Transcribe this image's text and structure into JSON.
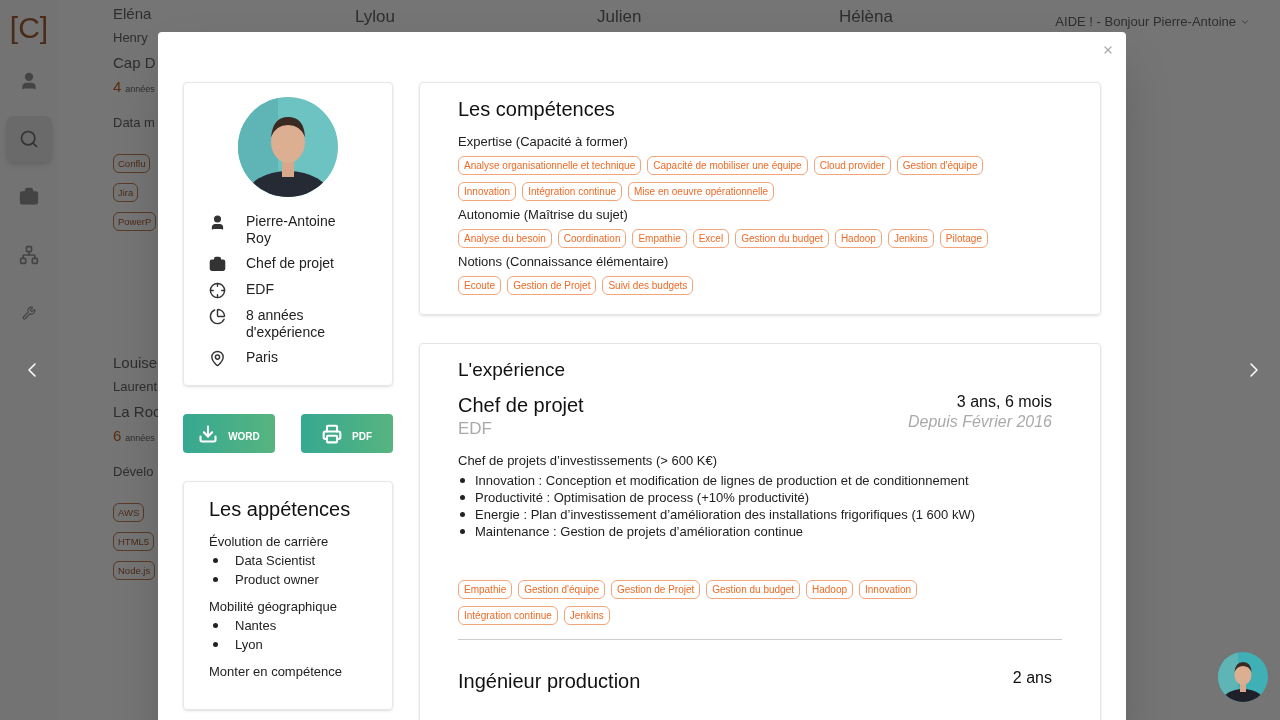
{
  "sidebar": {
    "logo": "[C]",
    "items": [
      {
        "kind": "user",
        "selected": false
      },
      {
        "kind": "search",
        "selected": true
      },
      {
        "kind": "briefcase",
        "selected": false
      },
      {
        "kind": "network",
        "selected": false
      },
      {
        "kind": "tools",
        "selected": false
      }
    ]
  },
  "header": {
    "greeting": "AIDE ! - Bonjour Pierre-Antoine"
  },
  "top_names": [
    "Lylou",
    "Julien",
    "Hélèna"
  ],
  "background_cards": [
    {
      "first_name": "Eléna",
      "last_name": "Henry",
      "company": "Cap D",
      "years": "4",
      "years_label": "années",
      "title": "Data m",
      "tags": [
        "Conflu",
        "Jira",
        "PowerP"
      ]
    },
    {
      "first_name": "Louise",
      "last_name": "Laurent",
      "company": "La Roc",
      "years": "6",
      "years_label": "années",
      "title": "Dévelo",
      "tags": [
        "AWS",
        "HTML5",
        "Node.js"
      ]
    }
  ],
  "modal": {
    "profile": {
      "rows": [
        {
          "kind": "person",
          "text": "Pierre-Antoine Roy"
        },
        {
          "kind": "job",
          "text": "Chef de projet"
        },
        {
          "kind": "company",
          "text": "EDF"
        },
        {
          "kind": "experience",
          "text": "8 années d'expérience"
        },
        {
          "kind": "location",
          "text": "Paris"
        }
      ]
    },
    "buttons": [
      {
        "kind": "download",
        "label": "WORD"
      },
      {
        "kind": "print",
        "label": "PDF"
      }
    ],
    "appetences": {
      "title": "Les appétences",
      "groups": [
        {
          "label": "Évolution de carrière",
          "items": [
            "Data Scientist",
            "Product owner"
          ]
        },
        {
          "label": "Mobilité géographique",
          "items": [
            "Nantes",
            "Lyon"
          ]
        },
        {
          "label": "Monter en compétence"
        }
      ]
    },
    "competences": {
      "title": "Les compétences",
      "groups": [
        {
          "label": "Expertise (Capacité à former)",
          "tags": [
            "Analyse organisationnelle et technique",
            "Capacité de mobiliser une équipe",
            "Cloud provider",
            "Gestion d'équipe",
            "Innovation",
            "Intégration continue",
            "Mise en oeuvre opérationnelle"
          ]
        },
        {
          "label": "Autonomie (Maîtrise du sujet)",
          "tags": [
            "Analyse du besoin",
            "Coordination",
            "Empathie",
            "Excel",
            "Gestion du budget",
            "Hadoop",
            "Jenkins",
            "Pilotage"
          ]
        },
        {
          "label": "Notions (Connaissance élémentaire)",
          "tags": [
            "Ecoute",
            "Gestion de Projet",
            "Suivi des budgets"
          ]
        }
      ]
    },
    "experience": {
      "title": "L'expérience",
      "jobs": [
        {
          "title": "Chef de projet",
          "company": "EDF",
          "duration": "3 ans, 6 mois",
          "since": "Depuis Février 2016",
          "summary": "Chef de projets d’investissements (> 600 K€)",
          "bullets": [
            "Innovation : Conception et modification de lignes de production et de conditionnement",
            "Productivité : Optimisation de process (+10% productivité)",
            "Energie : Plan d’investissement d’amélioration des installations frigorifiques (1 600 kW)",
            "Maintenance : Gestion de projets d’amélioration continue"
          ],
          "tags": [
            "Empathie",
            "Gestion d'équipe",
            "Gestion de Projet",
            "Gestion du budget",
            "Hadoop",
            "Innovation",
            "Intégration continue",
            "Jenkins"
          ]
        },
        {
          "title": "Ingénieur production",
          "duration": "2 ans"
        }
      ]
    }
  }
}
